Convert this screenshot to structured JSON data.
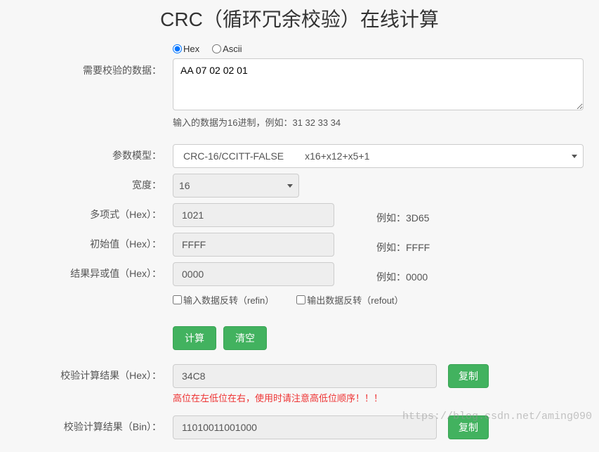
{
  "title": "CRC（循环冗余校验）在线计算",
  "radio": {
    "hex": "Hex",
    "ascii": "Ascii",
    "selected": "hex"
  },
  "data_input": {
    "label": "需要校验的数据：",
    "value": "AA 07 02 02 01",
    "hint": "输入的数据为16进制，例如：31 32 33 34"
  },
  "model": {
    "label": "参数模型：",
    "selected_name": "CRC-16/CCITT-FALSE",
    "selected_poly_str": "x16+x12+x5+1"
  },
  "width": {
    "label": "宽度：",
    "value": "16"
  },
  "poly": {
    "label": "多项式（Hex）：",
    "value": "1021",
    "example": "例如：3D65"
  },
  "init": {
    "label": "初始值（Hex）：",
    "value": "FFFF",
    "example": "例如：FFFF"
  },
  "xorout": {
    "label": "结果异或值（Hex）：",
    "value": "0000",
    "example": "例如：0000"
  },
  "refin": {
    "label": "输入数据反转（refin）",
    "checked": false
  },
  "refout": {
    "label": "输出数据反转（refout）",
    "checked": false
  },
  "buttons": {
    "calc": "计算",
    "clear": "清空",
    "copy": "复制"
  },
  "result_hex": {
    "label": "校验计算结果（Hex）：",
    "value": "34C8",
    "warning": "高位在左低位在右，使用时请注意高低位顺序！！！"
  },
  "result_bin": {
    "label": "校验计算结果（Bin）：",
    "value": "11010011001000"
  },
  "watermark": "https://blog.csdn.net/aming090"
}
